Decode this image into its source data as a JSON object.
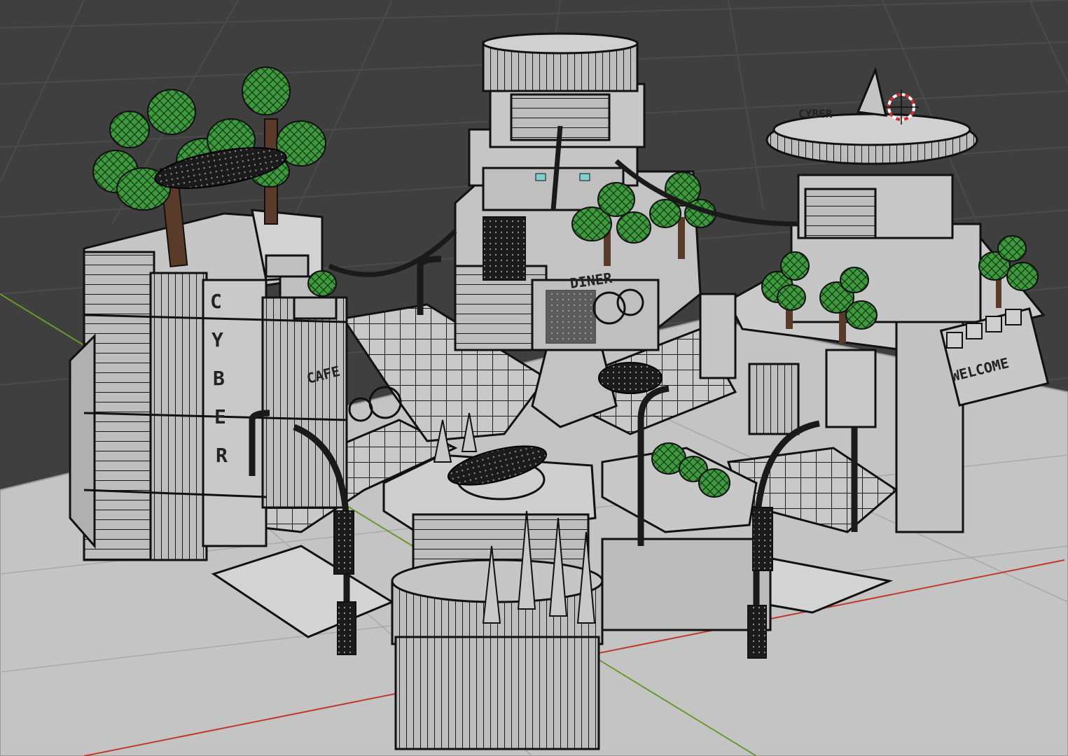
{
  "viewport": {
    "background": "#3f3f3f",
    "grid_color": "#4a4a4a",
    "ground_color": "#c4c4c4",
    "x_axis_color": "#c0392b",
    "y_axis_color": "#6a9a2a",
    "mesh_color": "#b5b5b5",
    "wire_color": "#111111",
    "tree_color": "#3f9a3f",
    "cursor": "3d-cursor-icon"
  },
  "scene": {
    "tower_left_sign": "CYBER",
    "tower_left_letters": [
      "C",
      "Y",
      "B",
      "E",
      "R"
    ],
    "cafe_sign": "CAFE",
    "center_sign": "DINER",
    "right_sign": "WELCOME",
    "rooftop_sign": "CYBER"
  }
}
